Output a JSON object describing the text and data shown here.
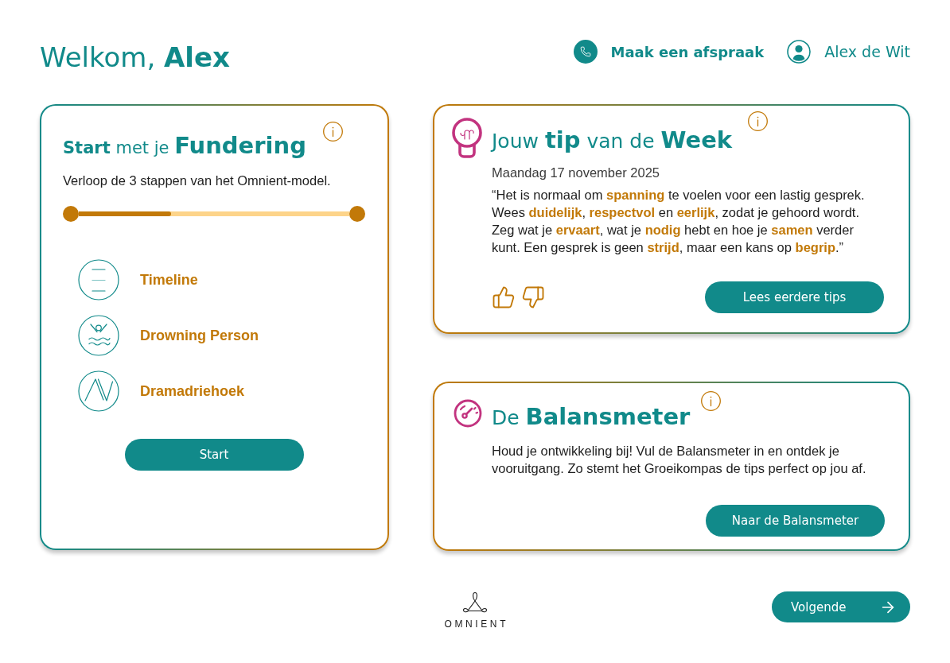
{
  "header": {
    "greeting": "Welkom, **Alex**",
    "appointment_link": "Maak een afspraak",
    "user_name": "Alex de Wit"
  },
  "fundering_card": {
    "title": [
      {
        "text": "Start",
        "kind": "bold"
      },
      {
        "text": "met je",
        "kind": "regular"
      },
      {
        "text": "Fundering",
        "kind": "large"
      }
    ],
    "subtitle": "Verloop de 3 stappen van het Omnient-model.",
    "progress": {
      "level": 0.34
    },
    "steps": [
      {
        "label": "Timeline"
      },
      {
        "label": "Drowning Person"
      },
      {
        "label": "Dramadriehoek"
      }
    ],
    "button": "Start"
  },
  "tip_card": {
    "title": [
      {
        "text": "Jouw",
        "kind": "regular"
      },
      {
        "text": "tip",
        "kind": "large"
      },
      {
        "text": "van de",
        "kind": "regular"
      },
      {
        "text": "Week",
        "kind": "large"
      }
    ],
    "date": "Maandag 17 november 2025",
    "quote": "“Het is normaal om **spanning** te voelen voor een lastig gesprek. Wees **duidelijk**, **respectvol** en **eerlijk**, zodat je gehoord wordt. Zeg wat je **ervaart**, wat je **nodig** hebt en hoe je **samen** verder kunt. Een gesprek is geen **strijd**, maar een kans op **begrip**.”",
    "button": "Lees eerdere tips"
  },
  "balansmeter_card": {
    "title": [
      {
        "text": "De",
        "kind": "regular"
      },
      {
        "text": "Balansmeter",
        "kind": "large"
      }
    ],
    "text": "Houd je ontwikkeling bij! Vul de Balansmeter in en ontdek je vooruitgang. Zo stemt het Groeikompas de tips perfect op jou af.",
    "button": "Naar de Balansmeter"
  },
  "footer": {
    "logo_text": "OMNIENT",
    "next_button": "Volgende"
  }
}
